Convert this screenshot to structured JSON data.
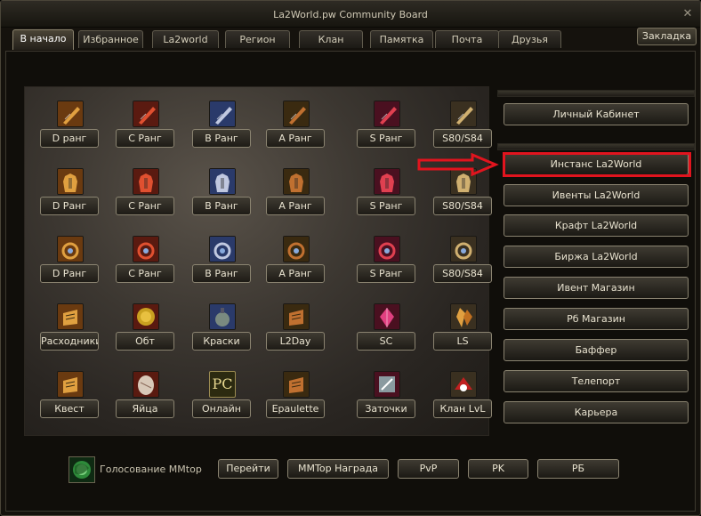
{
  "window": {
    "title": "La2World.pw Community Board",
    "close": "✕"
  },
  "tabs": [
    "В начало",
    "Избранное",
    "La2world",
    "Регион",
    "Клан",
    "Памятка",
    "Почта",
    "Друзья"
  ],
  "bookmark_label": "Закладка",
  "grid": [
    [
      "D ранг",
      "C Ранг",
      "B Ранг",
      "A Ранг",
      "S Ранг",
      "S80/S84"
    ],
    [
      "D Ранг",
      "C Ранг",
      "B Ранг",
      "A Ранг",
      "S Ранг",
      "S80/S84"
    ],
    [
      "D Ранг",
      "C Ранг",
      "B Ранг",
      "A Ранг",
      "S Ранг",
      "S80/S84"
    ],
    [
      "Расходники",
      "Обт",
      "Краски",
      "L2Day",
      "SC",
      "LS"
    ],
    [
      "Квест",
      "Яйца",
      "Онлайн",
      "Epaulette",
      "Заточки",
      "Клан LvL"
    ]
  ],
  "grid_icons": [
    [
      "bow-icon",
      "sword-icon",
      "dagger-icon",
      "axe-icon",
      "gun-icon",
      "claw-icon"
    ],
    [
      "heavy-armor-icon",
      "robe-icon",
      "plate-armor-icon",
      "robe-armor-icon",
      "heavy-armor-icon",
      "wing-armor-icon"
    ],
    [
      "necklace-icon",
      "ring-icon",
      "earring-icon",
      "ring-icon",
      "necklace-icon",
      "earring-icon"
    ],
    [
      "scroll-icon",
      "coin-icon",
      "potion-icon",
      "scroll-icon",
      "crystal-icon",
      "crystal-icon"
    ],
    [
      "quest-icon",
      "egg-icon",
      "pc-icon",
      "epaulette-icon",
      "enchant-icon",
      "clan-icon"
    ]
  ],
  "pc_icon_text": "PC",
  "right_buttons": [
    "Личный Кабинет",
    "Инстанс La2World",
    "Ивенты La2World",
    "Крафт La2World",
    "Биржа La2World",
    "Ивент Магазин",
    "Рб Магазин",
    "Баффер",
    "Телепорт",
    "Карьера"
  ],
  "highlighted_button": "Инстанс La2World",
  "bottom": {
    "vote_label": "Голосование MMtop",
    "buttons": [
      "Перейти",
      "MMTop Награда",
      "PvP",
      "PK",
      "РБ"
    ]
  },
  "colors": {
    "highlight": "#e1141e",
    "text": "#e8e2cf",
    "panel": "#15120d"
  }
}
